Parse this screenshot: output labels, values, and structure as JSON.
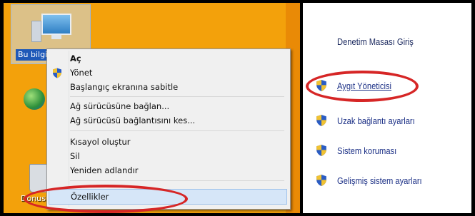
{
  "desktop": {
    "computer_icon_label": "Bu bilgisayar",
    "recycle_bin_label": "Donusu..."
  },
  "context_menu": {
    "items": [
      {
        "label": "Aç",
        "bold": true,
        "icon": ""
      },
      {
        "label": "Yönet",
        "icon": "uac-shield-icon"
      },
      {
        "label": "Başlangıç ekranına sabitle",
        "icon": ""
      },
      {
        "label": "Ağ sürücüsüne bağlan...",
        "icon": ""
      },
      {
        "label": "Ağ sürücüsü bağlantısını kes...",
        "icon": ""
      },
      {
        "label": "Kısayol oluştur",
        "icon": ""
      },
      {
        "label": "Sil",
        "icon": ""
      },
      {
        "label": "Yeniden adlandır",
        "icon": ""
      },
      {
        "label": "Özellikler",
        "icon": "",
        "highlighted": true
      }
    ]
  },
  "control_panel": {
    "header": "Denetim Masası Giriş",
    "tasks": [
      {
        "label": "Aygıt Yöneticisi",
        "icon": "uac-shield-icon",
        "highlighted": true
      },
      {
        "label": "Uzak bağlantı ayarları",
        "icon": "uac-shield-icon"
      },
      {
        "label": "Sistem koruması",
        "icon": "uac-shield-icon"
      },
      {
        "label": "Gelişmiş sistem ayarları",
        "icon": "uac-shield-icon"
      }
    ]
  },
  "colors": {
    "desktop_background": "#f3a10b",
    "highlight_ellipse": "#d62626",
    "link": "#1e3287",
    "menu_highlight": "#d6e6f8"
  }
}
